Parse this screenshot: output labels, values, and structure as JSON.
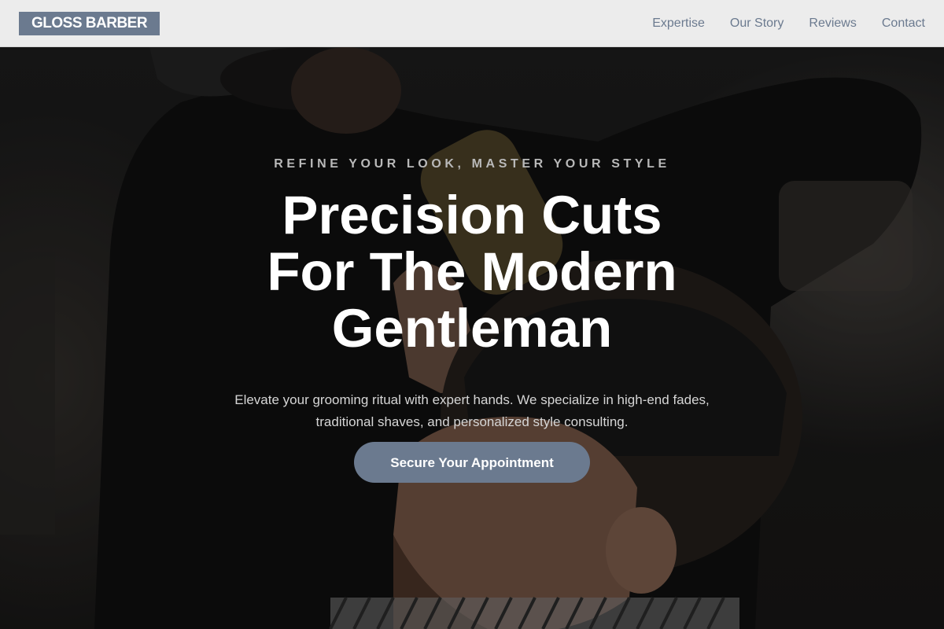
{
  "header": {
    "logo": "GLOSS BARBER",
    "nav": [
      "Expertise",
      "Our Story",
      "Reviews",
      "Contact"
    ]
  },
  "hero": {
    "eyebrow": "REFINE YOUR LOOK, MASTER YOUR STYLE",
    "headline": "Precision Cuts For The Modern Gentleman",
    "subtext": "Elevate your grooming ritual with expert hands. We specialize in high-end fades, traditional shaves, and personalized style consulting.",
    "cta": "Secure Your Appointment"
  },
  "colors": {
    "accent": "#6b7a8f",
    "header_bg": "#ececec",
    "headline": "#ffffff"
  }
}
